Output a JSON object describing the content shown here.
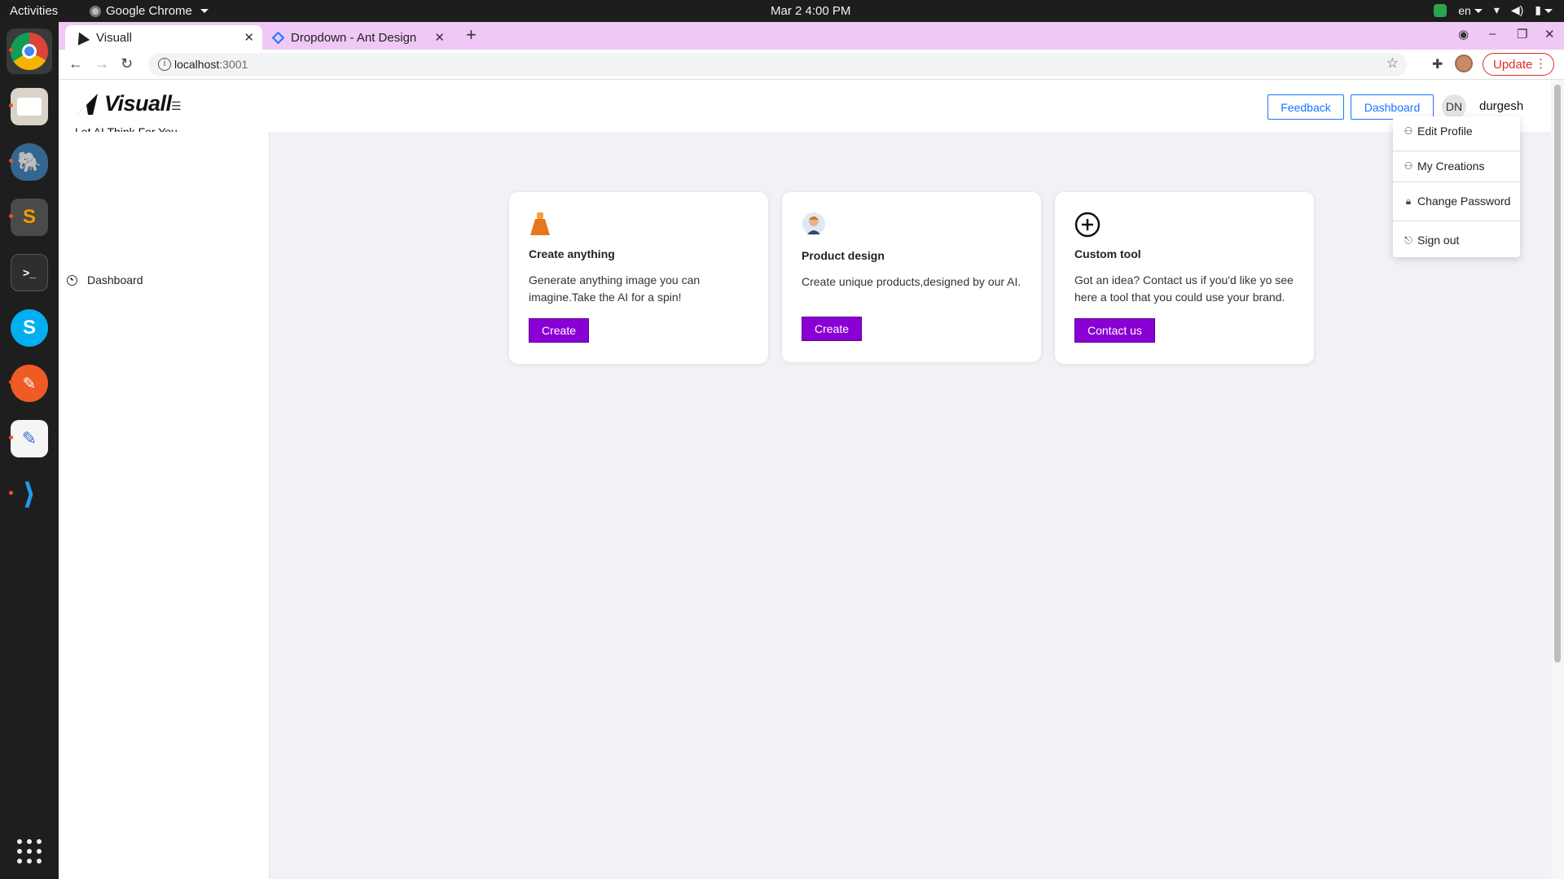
{
  "system_bar": {
    "activities": "Activities",
    "app_name": "Google Chrome",
    "clock": "Mar 2  4:00 PM",
    "language": "en"
  },
  "dock": {
    "apps": [
      "chrome-icon",
      "files-icon",
      "postgres-icon",
      "sublime-icon",
      "terminal-icon",
      "skype-icon",
      "postman-icon",
      "text-editor-icon",
      "vscode-icon",
      "app-grid-icon"
    ]
  },
  "browser": {
    "tabs": [
      {
        "title": "Visuall",
        "active": true
      },
      {
        "title": "Dropdown - Ant Design",
        "active": false
      }
    ],
    "url_host": "localhost",
    "url_port": ":3001",
    "update_label": "Update"
  },
  "app": {
    "brand": "Visuall",
    "tagline": "Let AI Think For You",
    "sidebar": {
      "items": [
        {
          "label": "Dashboard"
        }
      ]
    },
    "header": {
      "feedback_label": "Feedback",
      "dashboard_label": "Dashboard",
      "avatar_initials": "DN",
      "username": "durgesh"
    },
    "cards": [
      {
        "title": "Create anything",
        "description": "Generate anything image you can imagine.Take the AI for a spin!",
        "button": "Create",
        "icon": "dress-icon"
      },
      {
        "title": "Product design",
        "description": "Create unique products,designed by our AI.",
        "button": "Create",
        "icon": "person-avatar-icon"
      },
      {
        "title": "Custom tool",
        "description": "Got an idea? Contact us if you'd like yo see here a tool that you could use your brand.",
        "button": "Contact us",
        "icon": "plus-circle-icon"
      }
    ],
    "user_menu": {
      "items": [
        {
          "label": "Edit Profile",
          "icon": "user-icon"
        },
        {
          "label": "My Creations",
          "icon": "user-icon"
        },
        {
          "label": "Change Password",
          "icon": "lock-icon"
        },
        {
          "label": "Sign out",
          "icon": "logout-icon"
        }
      ]
    },
    "colors": {
      "accent": "#8a00d4",
      "link_blue": "#1677ff"
    }
  }
}
